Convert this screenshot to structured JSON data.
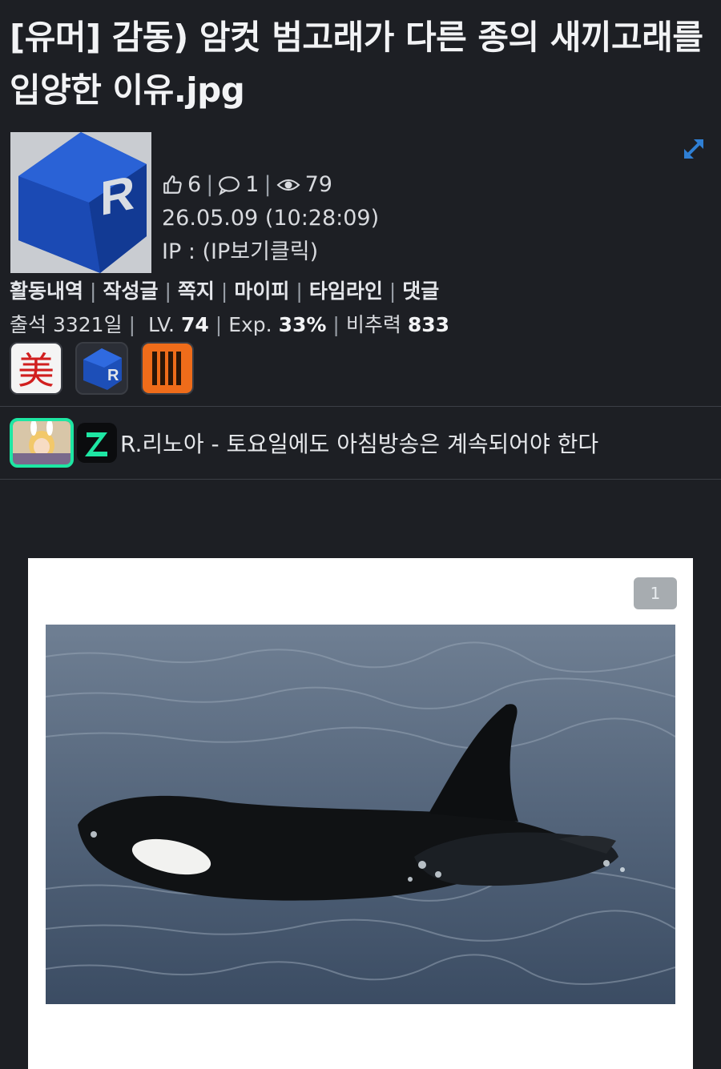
{
  "post": {
    "title": "[유머] 감동) 암컷 범고래가 다른 종의 새끼고래를 입양한 이유.jpg"
  },
  "author": {
    "likes": "6",
    "comments": "1",
    "views": "79",
    "datetime": "26.05.09 (10:28:09)",
    "ip": "IP : (IP보기클릭)",
    "avatar_letter": "R"
  },
  "links": [
    "활동내역",
    "작성글",
    "쪽지",
    "마이피",
    "타임라인",
    "댓글"
  ],
  "stats": {
    "attendance_label": "출석",
    "attendance_value": "3321일",
    "level_label": "LV.",
    "level_value": "74",
    "exp_label": "Exp.",
    "exp_value": "33%",
    "ratio_label": "비추력",
    "ratio_value": "833"
  },
  "badges": [
    {
      "name": "badge-hanja",
      "glyph": "美"
    },
    {
      "name": "badge-cube",
      "glyph": "R"
    },
    {
      "name": "badge-orange",
      "glyph": "IIII"
    }
  ],
  "signature": {
    "text": "R.리노아 - 토요일에도 아침방송은 계속되어야 한다"
  },
  "image": {
    "counter": "1"
  },
  "colors": {
    "background": "#1d1f24",
    "accent_green": "#1ee6a3",
    "link_blue": "#2f7fd4",
    "cube_blue": "#1d4fb8"
  }
}
